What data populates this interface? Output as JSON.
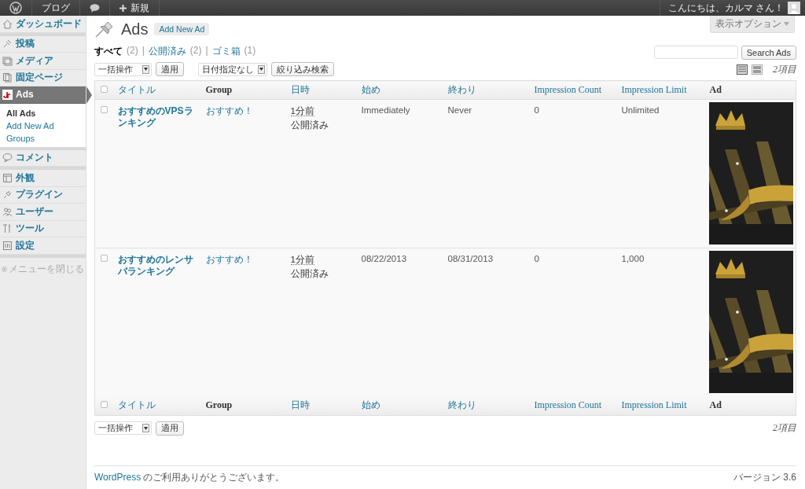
{
  "admin_bar": {
    "site": "ブログ",
    "new": "新規",
    "greeting": "こんにちは、カルマ さん！"
  },
  "sidebar": {
    "groups": [
      [
        {
          "label": "ダッシュボード",
          "selected": false
        }
      ],
      [
        {
          "label": "投稿",
          "selected": false
        },
        {
          "label": "メディア",
          "selected": false
        },
        {
          "label": "固定ページ",
          "selected": false
        },
        {
          "label": "Ads",
          "selected": true,
          "children": [
            {
              "label": "All Ads",
              "selected": true
            },
            {
              "label": "Add New Ad",
              "selected": false
            },
            {
              "label": "Groups",
              "selected": false
            }
          ]
        }
      ],
      [
        {
          "label": "コメント",
          "selected": false
        }
      ],
      [
        {
          "label": "外観",
          "selected": false
        },
        {
          "label": "プラグイン",
          "selected": false
        },
        {
          "label": "ユーザー",
          "selected": false
        },
        {
          "label": "ツール",
          "selected": false
        },
        {
          "label": "設定",
          "selected": false
        }
      ]
    ],
    "collapse": "メニューを閉じる"
  },
  "screen_options": "表示オプション",
  "header": {
    "title": "Ads",
    "add_new": "Add New Ad"
  },
  "filters": {
    "separator": "|",
    "items": [
      {
        "label": "すべて",
        "count": "(2)",
        "selected": true
      },
      {
        "label": "公開済み",
        "count": "(2)",
        "selected": false
      },
      {
        "label": "ゴミ箱",
        "count": "(1)",
        "selected": false
      }
    ]
  },
  "search": {
    "button": "Search Ads"
  },
  "top_nav": {
    "bulk": "一括操作",
    "apply": "適用",
    "date": "日付指定なし",
    "filter": "絞り込み検索",
    "views": [
      {
        "kind": "list",
        "selected": true
      },
      {
        "kind": "excerpt",
        "selected": false
      }
    ],
    "count": "2項目"
  },
  "table": {
    "select_all_checked": false,
    "columns": [
      {
        "label": "タイトル",
        "sortable": true
      },
      {
        "label": "Group",
        "sortable": false
      },
      {
        "label": "日時",
        "sortable": true
      },
      {
        "label": "始め",
        "sortable": true
      },
      {
        "label": "終わり",
        "sortable": true
      },
      {
        "label": "Impression Count",
        "sortable": true
      },
      {
        "label": "Impression Limit",
        "sortable": true
      },
      {
        "label": "Ad",
        "sortable": false
      }
    ],
    "rows": [
      {
        "checked": false,
        "title": "おすすめのVPSランキング",
        "group": "おすすめ！",
        "date": "1分前",
        "status": "公開済み",
        "start": "Immediately",
        "end": "Never",
        "impression_count": "0",
        "impression_limit": "Unlimited"
      },
      {
        "checked": false,
        "title": "おすすめのレンサバランキング",
        "group": "おすすめ！",
        "date": "1分前",
        "status": "公開済み",
        "start": "08/22/2013",
        "end": "08/31/2013",
        "impression_count": "0",
        "impression_limit": "1,000"
      }
    ],
    "footer_columns": [
      {
        "label": "タイトル",
        "sortable": true
      },
      {
        "label": "Group",
        "sortable": false
      },
      {
        "label": "日時",
        "sortable": true
      },
      {
        "label": "始め",
        "sortable": true
      },
      {
        "label": "終わり",
        "sortable": true
      },
      {
        "label": "Impression Count",
        "sortable": true
      },
      {
        "label": "Impression Limit",
        "sortable": true
      },
      {
        "label": "Ad",
        "sortable": false
      }
    ],
    "footer_select_all_checked": false
  },
  "bottom_nav": {
    "bulk": "一括操作",
    "apply": "適用",
    "count": "2項目"
  },
  "footer": {
    "link": "WordPress",
    "thanks": "のご利用ありがとうございます。",
    "version": "バージョン 3.6"
  }
}
